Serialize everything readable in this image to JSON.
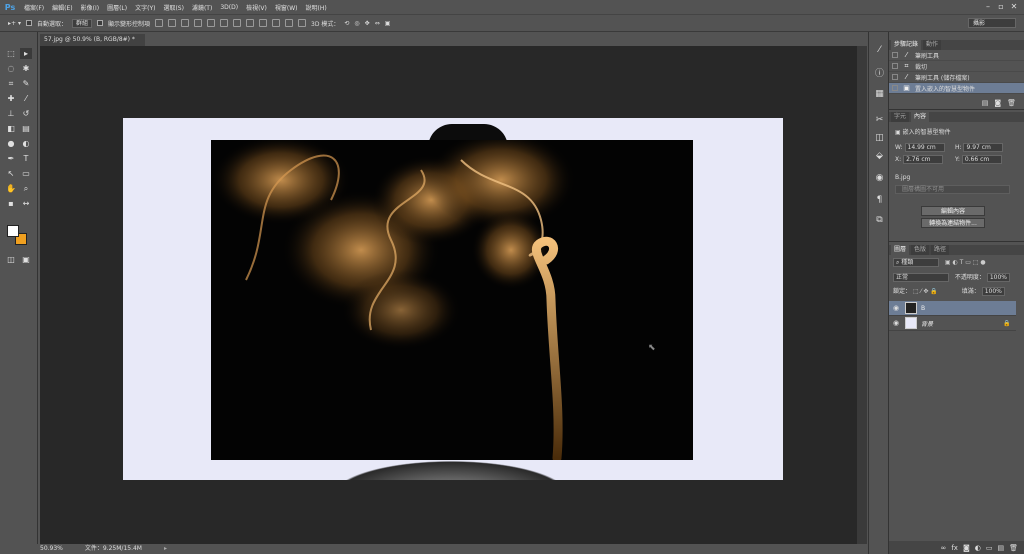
{
  "menubar": {
    "logo": "Ps",
    "items": [
      "檔案(F)",
      "編輯(E)",
      "影像(I)",
      "圖層(L)",
      "文字(Y)",
      "選取(S)",
      "濾鏡(T)",
      "3D(D)",
      "檢視(V)",
      "視窗(W)",
      "說明(H)"
    ]
  },
  "options": {
    "auto_select_label": "自動選取：",
    "auto_select_value": "群組",
    "transform_label": "顯示變形控制項",
    "mode_3d_label": "3D 模式："
  },
  "workspace": {
    "value": "攝影"
  },
  "document": {
    "tab_title": "57.jpg @ 50.9% (B, RGB/8#) *"
  },
  "status": {
    "zoom": "50.93%",
    "file_info": "文件：9.25M/15.4M"
  },
  "history": {
    "tabs": [
      "步驟記錄",
      "動作"
    ],
    "rows": [
      "筆刷工具",
      "裁切",
      "筆刷工具 (儲存檔案)",
      "置入嵌入的智慧型物件"
    ]
  },
  "properties": {
    "tabs": [
      "字元",
      "內容"
    ],
    "object_type": "嵌入的智慧型物件",
    "w_label": "W:",
    "w_value": "14.99 cm",
    "h_label": "H:",
    "h_value": "9.97 cm",
    "x_label": "X:",
    "x_value": "2.76 cm",
    "y_label": "Y:",
    "y_value": "0.66 cm",
    "file_name": "B.jpg",
    "comp_placeholder": "圖層構圖不可用",
    "edit_button": "編輯內容",
    "convert_button": "轉換為連結物件..."
  },
  "layers": {
    "tabs": [
      "圖層",
      "色版",
      "路徑"
    ],
    "filter_kind": "種類",
    "blend_mode": "正常",
    "opacity_label": "不透明度：",
    "opacity_value": "100%",
    "lock_label": "鎖定：",
    "fill_label": "填滿：",
    "fill_value": "100%",
    "rows": [
      {
        "name": "B",
        "active": true
      },
      {
        "name": "背景",
        "active": false
      }
    ]
  },
  "colors": {
    "foreground": "#ffffff",
    "background": "#f0a020"
  }
}
